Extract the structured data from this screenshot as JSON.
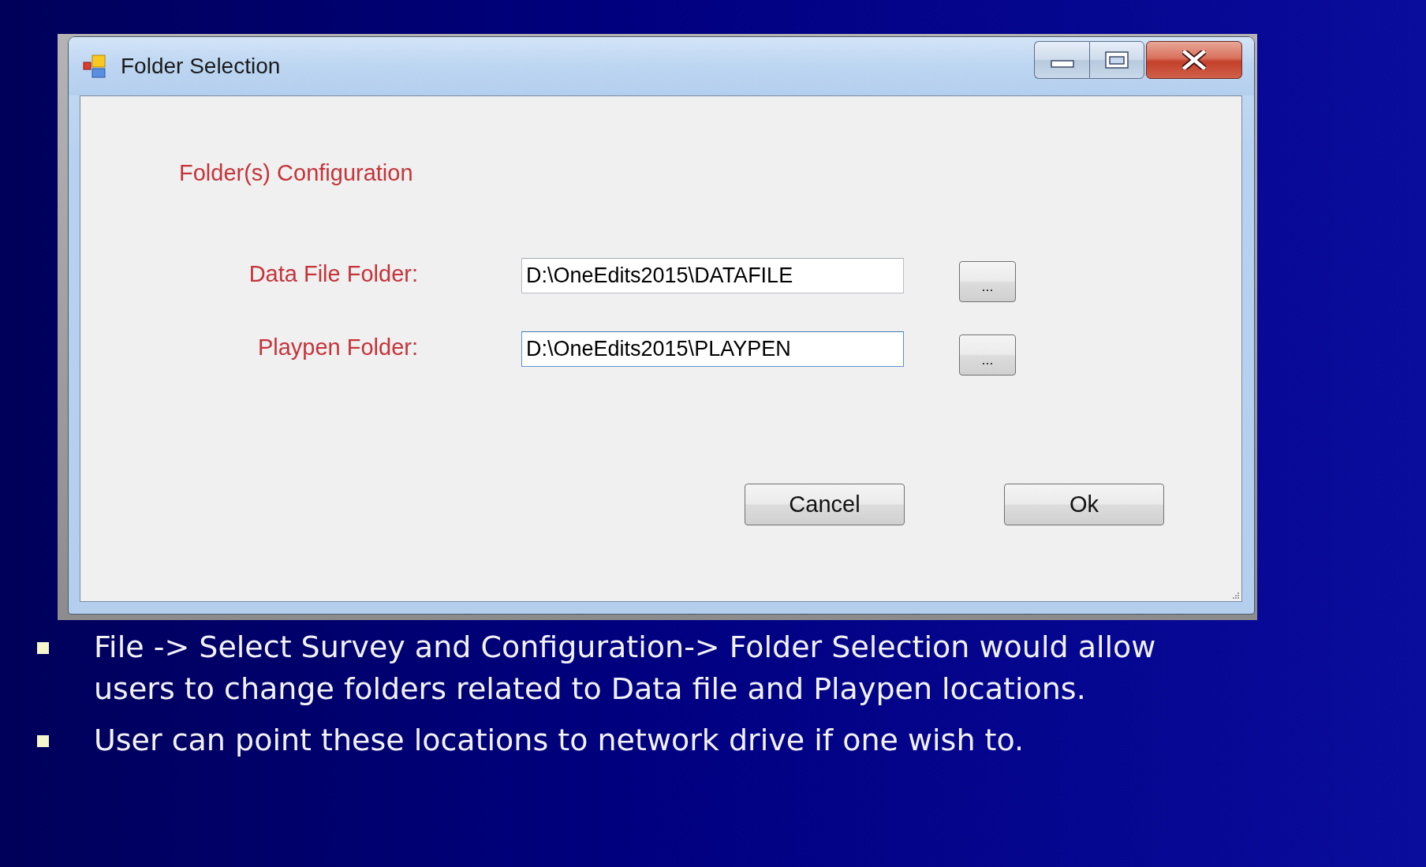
{
  "window": {
    "title": "Folder Selection"
  },
  "form": {
    "heading": "Folder(s) Configuration",
    "fields": [
      {
        "label": "Data File Folder:",
        "value": "D:\\OneEdits2015\\DATAFILE",
        "focused": false,
        "browse_button": "..."
      },
      {
        "label": "Playpen Folder:",
        "value": "D:\\OneEdits2015\\PLAYPEN",
        "focused": true,
        "browse_button": "..."
      }
    ],
    "buttons": [
      "Cancel",
      "Ok"
    ]
  },
  "bullets": [
    "File -> Select Survey and Configuration-> Folder Selection would allow users to change folders related to Data file and Playpen locations.",
    "User can point these locations to network drive if one wish to."
  ]
}
